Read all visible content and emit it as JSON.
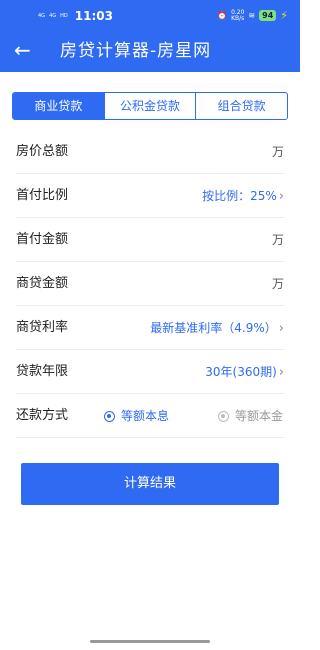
{
  "status_bar": {
    "signal1": "4G",
    "signal2": "4G",
    "hd": "HD",
    "time": "11:03",
    "net_speed": "0.20\nKB/s",
    "battery": "94"
  },
  "header": {
    "back_icon": "arrow-left",
    "title": "房贷计算器-房星网"
  },
  "tabs": [
    {
      "label": "商业贷款",
      "active": true
    },
    {
      "label": "公积金贷款",
      "active": false
    },
    {
      "label": "组合贷款",
      "active": false
    }
  ],
  "rows": {
    "total_price": {
      "label": "房价总额",
      "unit": "万"
    },
    "down_ratio": {
      "label": "首付比例",
      "value": "按比例：25%"
    },
    "down_amount": {
      "label": "首付金额",
      "unit": "万"
    },
    "loan_amount": {
      "label": "商贷金额",
      "unit": "万"
    },
    "rate": {
      "label": "商贷利率",
      "value": "最新基准利率（4.9%）"
    },
    "term": {
      "label": "贷款年限",
      "value": "30年(360期)"
    },
    "repay": {
      "label": "还款方式",
      "option1": "等额本息",
      "option2": "等额本金",
      "selected": "等额本息"
    }
  },
  "calc_button": "计算结果",
  "colors": {
    "accent": "#2f6bf2"
  }
}
